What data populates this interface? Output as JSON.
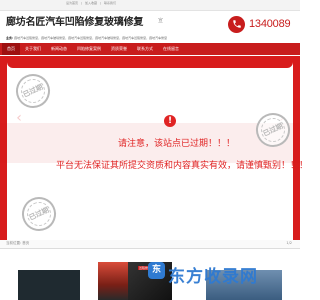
{
  "topbar": {
    "links": [
      "设为首页",
      "|",
      "加入收藏",
      "|",
      "联系我们"
    ]
  },
  "header": {
    "title": "廊坊名匠汽车凹陷修复玻璃修复",
    "title_mark": "宣",
    "tags_label": "业务:",
    "tags": "廊坊汽车凹陷修复，廊坊汽车玻璃修复，廊坊汽车凹陷修复，廊坊汽车玻璃修复，廊坊汽车凹陷修复，廊坊汽车修复"
  },
  "phone": {
    "icon": "phone-icon",
    "number": "1340089"
  },
  "nav": {
    "items": [
      "首页",
      "关于我们",
      "新闻动态",
      "凹陷修复案例",
      "资质荣誉",
      "联系方式",
      "在线留言"
    ]
  },
  "banner": {
    "arrow_left": "‹",
    "arrow_right": "›",
    "stamp_text": "已过期",
    "alert_icon": "!",
    "alert_line1": "请注意，该站点已过期！！！",
    "alert_line2": "平台无法保证其所提交资质和内容真实有效，请谨慎甄别！！！"
  },
  "breadcrumb": {
    "text": "当前位置: 首页",
    "page_indicator": "1/2"
  },
  "gallery": {
    "tag": "凹陷修复",
    "watermark_logo": "东",
    "watermark_text": "东方收录网"
  },
  "colors": {
    "brand_red": "#c81d1d",
    "alert_red": "#e02424",
    "watermark_blue": "#2f7ad1"
  }
}
